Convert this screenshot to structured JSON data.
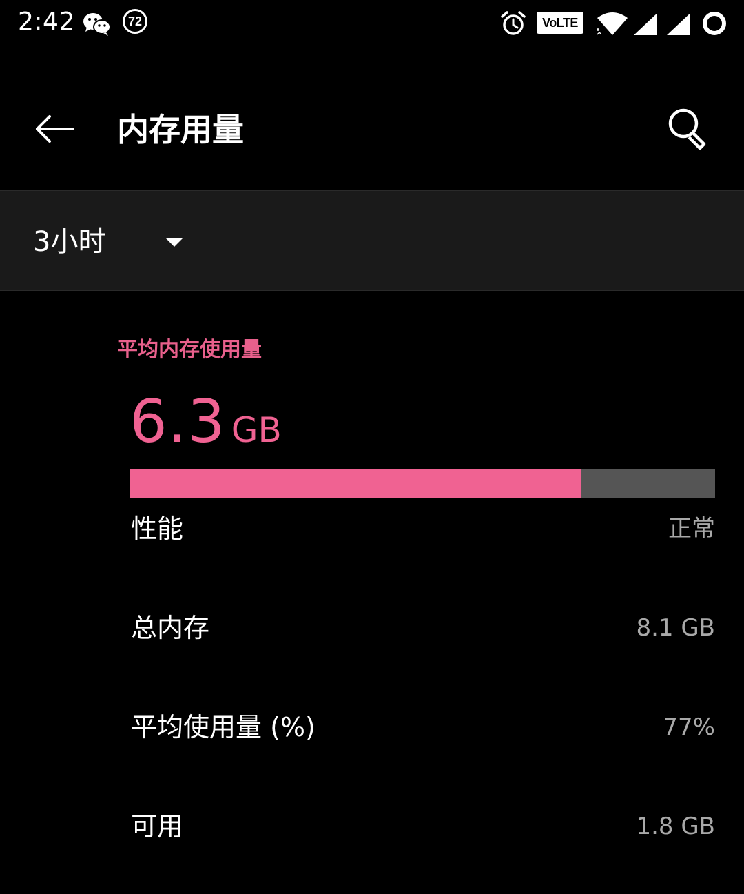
{
  "status_bar": {
    "time": "2:42",
    "notification_count": "72",
    "volte_label": "VoLTE",
    "icons": [
      "wechat-icon",
      "alarm-icon",
      "volte-icon",
      "wifi-icon",
      "signal-icon",
      "signal-icon",
      "loading-ring-icon"
    ]
  },
  "app_bar": {
    "title": "内存用量",
    "back_icon": "arrow-left-icon",
    "search_icon": "search-icon"
  },
  "filter": {
    "selected": "3小时"
  },
  "summary": {
    "label": "平均内存使用量",
    "value": "6.3",
    "unit": "GB",
    "usage_fraction": 0.77,
    "colors": {
      "accent": "#f06292",
      "bar_track": "#555555"
    }
  },
  "rows": [
    {
      "label": "性能",
      "value": "正常"
    },
    {
      "label": "总内存",
      "value": "8.1 GB"
    },
    {
      "label": "平均使用量 (%)",
      "value": "77%"
    },
    {
      "label": "可用",
      "value": "1.8 GB"
    }
  ]
}
